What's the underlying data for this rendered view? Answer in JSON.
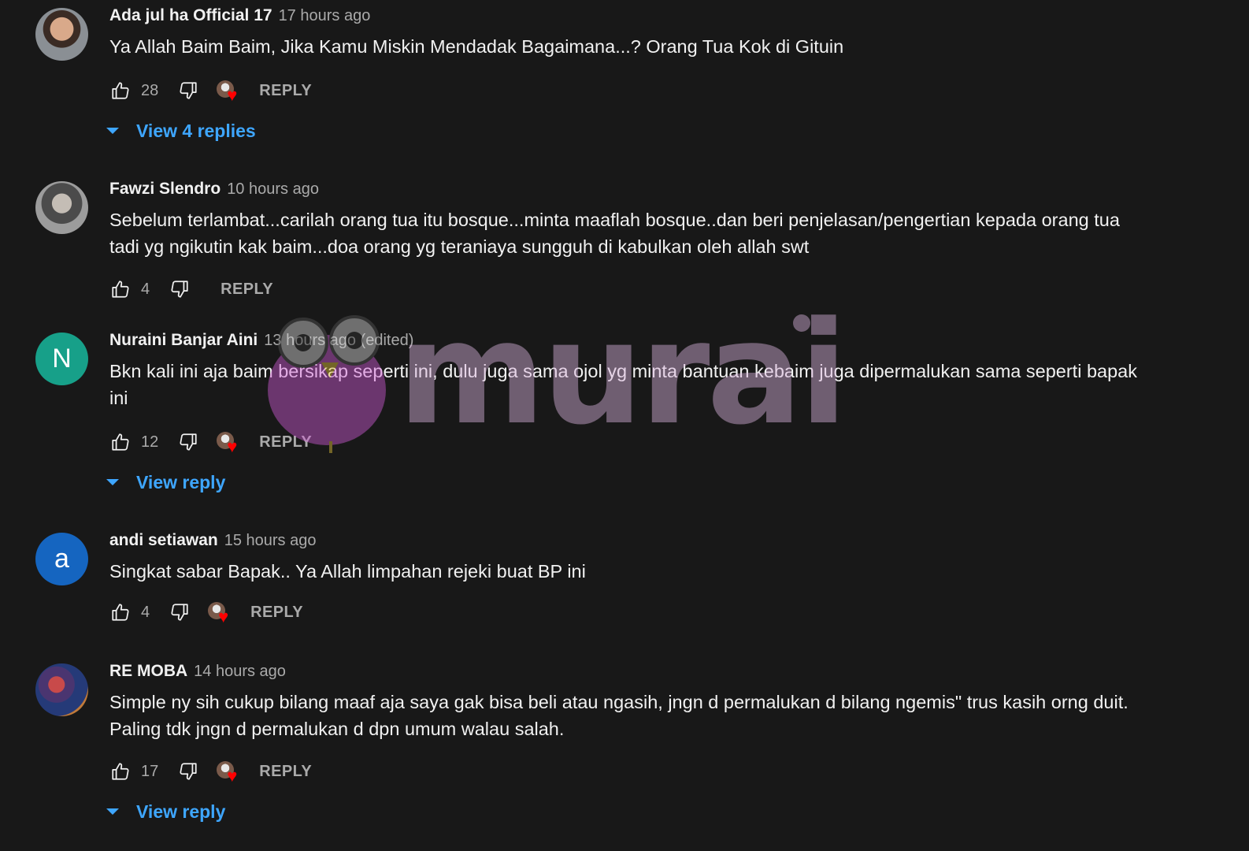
{
  "colors": {
    "background": "#181818",
    "text": "#f1f1f1",
    "muted": "#aaaaaa",
    "link": "#3ea6ff",
    "heart": "#ff0000"
  },
  "icons": {
    "like": "thumb-up-icon",
    "dislike": "thumb-down-icon",
    "hearted": "creator-heart-icon",
    "expand": "triangle-down-icon"
  },
  "watermark": {
    "text": "murai"
  },
  "comments": [
    {
      "author": "Ada jul ha Official 17",
      "time": "17 hours ago",
      "text": "Ya Allah Baim Baim, Jika Kamu Miskin Mendadak Bagaimana...? Orang Tua Kok di Gituin",
      "likes": "28",
      "reply_label": "REPLY",
      "view_replies": "View 4 replies"
    },
    {
      "author": "Fawzi Slendro",
      "time": "10 hours ago",
      "text": "Sebelum terlambat...carilah orang tua itu bosque...minta maaflah bosque..dan beri penjelasan/pengertian kepada orang tua tadi yg ngikutin kak baim...doa orang yg teraniaya sungguh di kabulkan oleh allah swt",
      "likes": "4",
      "reply_label": "REPLY"
    },
    {
      "author": "Nuraini Banjar Aini",
      "avatar_letter": "N",
      "time": "13 hours ago (edited)",
      "text": "Bkn kali ini aja baim bersikap seperti ini, dulu juga sama ojol yg minta bantuan kebaim juga dipermalukan sama seperti bapak ini",
      "likes": "12",
      "reply_label": "REPLY",
      "view_replies": "View reply"
    },
    {
      "author": "andi setiawan",
      "avatar_letter": "a",
      "time": "15 hours ago",
      "text": "Singkat sabar Bapak..  Ya Allah limpahan rejeki buat BP ini",
      "likes": "4",
      "reply_label": "REPLY"
    },
    {
      "author": "RE MOBA",
      "time": "14 hours ago",
      "text": "Simple ny sih cukup bilang maaf aja saya gak bisa beli atau ngasih, jngn d permalukan d bilang ngemis\" trus kasih orng duit. Paling tdk jngn d permalukan d dpn umum walau salah.",
      "likes": "17",
      "reply_label": "REPLY",
      "view_replies": "View reply"
    }
  ]
}
